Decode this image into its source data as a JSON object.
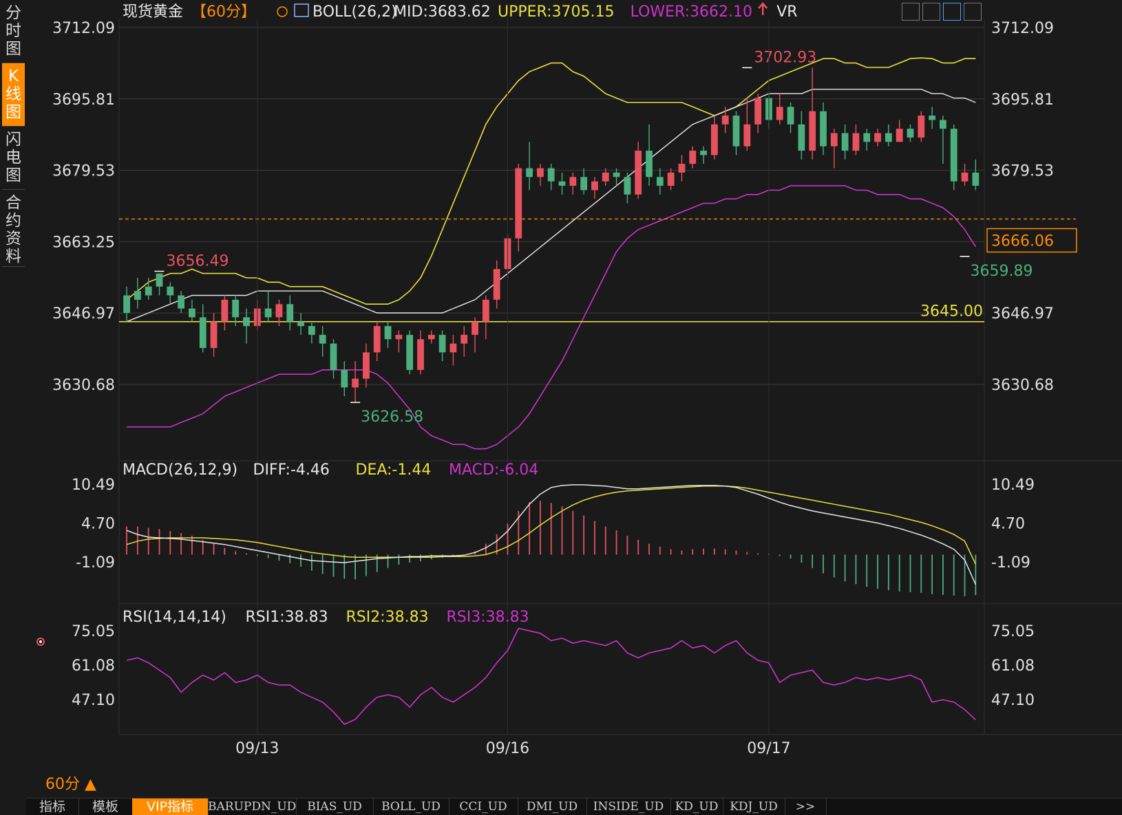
{
  "sidebar": {
    "tabs": [
      "分时图",
      "K线图",
      "闪电图",
      "合约资料"
    ],
    "active": 1
  },
  "period_indicator": "60分 ▲",
  "bottom_tabs": [
    "指标",
    "模板",
    "VIP指标",
    "BARUPDN_UD",
    "BIAS_UD",
    "BOLL_UD",
    "CCI_UD",
    "DMI_UD",
    "INSIDE_UD",
    "KD_UD",
    "KDJ_UD",
    ">>"
  ],
  "active_bottom_tab": 2,
  "colors": {
    "background": "#1a1a1a",
    "grid": "#3a3a3a",
    "up": "#e8525e",
    "down": "#4caf7d",
    "mid": "#e8e8e8",
    "upper": "#e8e040",
    "lower": "#cc33cc",
    "accent": "#ff8c00",
    "highlight_high": "#e8525e",
    "highlight_low": "#4caf7d"
  },
  "toolbar_icons": [
    "grid-icon",
    "bar-chart-icon",
    "line-chart-icon",
    "fullscreen-icon"
  ],
  "chart_data": [
    {
      "type": "candlestick",
      "panel": "main",
      "title": "现货黄金",
      "period_label": "【60分】",
      "indicator_label": "BOLL(26,2)",
      "mid_label": "MID:3683.62",
      "upper_label": "UPPER:3705.15",
      "lower_label": "LOWER:3662.10",
      "extra_label": "VR",
      "y_ticks": [
        "3712.09",
        "3695.81",
        "3679.53",
        "3663.25",
        "3646.97",
        "3630.68"
      ],
      "x_labels": [
        "09/13",
        "09/16",
        "09/17"
      ],
      "x_label_index": [
        12,
        35,
        59
      ],
      "current_price": "3666.06",
      "horizontal_line_label": "3645.00",
      "annotations": [
        {
          "text": "3656.49",
          "index": 3,
          "value": 3656.49,
          "kind": "high"
        },
        {
          "text": "3626.58",
          "index": 21,
          "value": 3626.58,
          "kind": "low"
        },
        {
          "text": "3702.93",
          "index": 57,
          "value": 3702.93,
          "kind": "high"
        },
        {
          "text": "3659.89",
          "index": 77,
          "value": 3659.89,
          "kind": "low"
        }
      ],
      "candles": [
        [
          3651,
          3647,
          3653,
          3645
        ],
        [
          3652,
          3650,
          3655,
          3648
        ],
        [
          3653,
          3651,
          3655,
          3650
        ],
        [
          3656,
          3653,
          3656,
          3651
        ],
        [
          3653,
          3651,
          3654,
          3649
        ],
        [
          3651,
          3648,
          3652,
          3647
        ],
        [
          3648,
          3646,
          3650,
          3645
        ],
        [
          3646,
          3639,
          3649,
          3638
        ],
        [
          3639,
          3645,
          3647,
          3637
        ],
        [
          3645,
          3650,
          3651,
          3643
        ],
        [
          3650,
          3646,
          3651,
          3644
        ],
        [
          3646,
          3644,
          3648,
          3640
        ],
        [
          3644,
          3648,
          3650,
          3643
        ],
        [
          3648,
          3646,
          3652,
          3645
        ],
        [
          3646,
          3649,
          3650,
          3644
        ],
        [
          3649,
          3645,
          3651,
          3643
        ],
        [
          3645,
          3644,
          3647,
          3642
        ],
        [
          3644,
          3642,
          3645,
          3640
        ],
        [
          3642,
          3640,
          3644,
          3637
        ],
        [
          3640,
          3634,
          3641,
          3632
        ],
        [
          3634,
          3630,
          3636,
          3628
        ],
        [
          3630,
          3632,
          3636,
          3626.58
        ],
        [
          3632,
          3638,
          3640,
          3630
        ],
        [
          3638,
          3644,
          3645,
          3636
        ],
        [
          3644,
          3641,
          3645,
          3639
        ],
        [
          3641,
          3642,
          3643,
          3638
        ],
        [
          3642,
          3634,
          3643,
          3633
        ],
        [
          3634,
          3641,
          3643,
          3633
        ],
        [
          3641,
          3642,
          3643,
          3640
        ],
        [
          3642,
          3638,
          3643,
          3636
        ],
        [
          3638,
          3640,
          3642,
          3635
        ],
        [
          3640,
          3642,
          3644,
          3637
        ],
        [
          3642,
          3645,
          3646,
          3638
        ],
        [
          3645,
          3650,
          3651,
          3641
        ],
        [
          3650,
          3657,
          3659,
          3648
        ],
        [
          3657,
          3664,
          3665,
          3655
        ],
        [
          3664,
          3680,
          3681,
          3661
        ],
        [
          3680,
          3678,
          3686,
          3675
        ],
        [
          3678,
          3680,
          3681,
          3676
        ],
        [
          3680,
          3677,
          3681,
          3675
        ],
        [
          3677,
          3676,
          3679,
          3674
        ],
        [
          3676,
          3678,
          3679,
          3674
        ],
        [
          3678,
          3675,
          3680,
          3674
        ],
        [
          3675,
          3677,
          3678,
          3673
        ],
        [
          3677,
          3679,
          3680,
          3676
        ],
        [
          3679,
          3678,
          3680,
          3676
        ],
        [
          3678,
          3674,
          3679,
          3672
        ],
        [
          3674,
          3684,
          3686,
          3673
        ],
        [
          3684,
          3678,
          3690,
          3676
        ],
        [
          3678,
          3676,
          3680,
          3674
        ],
        [
          3676,
          3679,
          3680,
          3675
        ],
        [
          3679,
          3681,
          3683,
          3677
        ],
        [
          3681,
          3684,
          3685,
          3680
        ],
        [
          3684,
          3683,
          3685,
          3681
        ],
        [
          3683,
          3690,
          3692,
          3682
        ],
        [
          3690,
          3692,
          3694,
          3688
        ],
        [
          3692,
          3685,
          3693,
          3683
        ],
        [
          3685,
          3690,
          3696,
          3684
        ],
        [
          3690,
          3696,
          3697,
          3688
        ],
        [
          3696,
          3691,
          3697,
          3689
        ],
        [
          3691,
          3694,
          3697,
          3690
        ],
        [
          3694,
          3690,
          3695,
          3688
        ],
        [
          3690,
          3684,
          3693,
          3682
        ],
        [
          3684,
          3693,
          3702.93,
          3682
        ],
        [
          3693,
          3685,
          3695,
          3683
        ],
        [
          3685,
          3688,
          3689,
          3680
        ],
        [
          3688,
          3684,
          3690,
          3682
        ],
        [
          3684,
          3688,
          3690,
          3683
        ],
        [
          3688,
          3686,
          3689,
          3684
        ],
        [
          3686,
          3688,
          3689,
          3685
        ],
        [
          3688,
          3686,
          3690,
          3685
        ],
        [
          3686,
          3689,
          3691,
          3686
        ],
        [
          3689,
          3687,
          3690,
          3686
        ],
        [
          3687,
          3692,
          3693,
          3686
        ],
        [
          3692,
          3691,
          3694,
          3689
        ],
        [
          3691,
          3689,
          3692,
          3681
        ],
        [
          3689,
          3677,
          3690,
          3675
        ],
        [
          3677,
          3679,
          3681,
          3676
        ],
        [
          3679,
          3676,
          3682,
          3675
        ]
      ],
      "boll_mid": [
        3645,
        3646,
        3647,
        3648,
        3649,
        3650,
        3651,
        3651,
        3651,
        3651,
        3651,
        3651,
        3652,
        3652,
        3652,
        3652,
        3652,
        3652,
        3652,
        3651,
        3650,
        3649,
        3648,
        3647,
        3647,
        3647,
        3647,
        3647,
        3647,
        3647,
        3648,
        3649,
        3650,
        3652,
        3654,
        3656,
        3658,
        3660,
        3662,
        3664,
        3666,
        3668,
        3670,
        3672,
        3674,
        3676,
        3678,
        3680,
        3682,
        3684,
        3686,
        3688,
        3690,
        3691,
        3692,
        3693,
        3694,
        3695,
        3696,
        3697,
        3697,
        3697,
        3697,
        3698,
        3698,
        3698,
        3698,
        3698,
        3698,
        3698,
        3698,
        3698,
        3698,
        3698,
        3697,
        3697,
        3696,
        3696,
        3695
      ],
      "boll_upper": [
        3650,
        3652,
        3654,
        3655,
        3656,
        3656,
        3657,
        3656,
        3656,
        3656,
        3656,
        3655,
        3655,
        3654,
        3654,
        3653,
        3653,
        3653,
        3653,
        3652,
        3651,
        3650,
        3649,
        3649,
        3649,
        3650,
        3652,
        3655,
        3660,
        3666,
        3672,
        3678,
        3684,
        3690,
        3694,
        3697,
        3700,
        3702,
        3703,
        3704,
        3704,
        3702,
        3701,
        3699,
        3697,
        3696,
        3695,
        3695,
        3695,
        3695,
        3695,
        3695,
        3694,
        3693,
        3692,
        3693,
        3694,
        3696,
        3698,
        3700,
        3701,
        3702,
        3703,
        3704,
        3705,
        3705,
        3704,
        3704,
        3703,
        3703,
        3703,
        3704,
        3705,
        3705.15,
        3705,
        3704,
        3704,
        3705,
        3705
      ],
      "boll_lower": [
        3621,
        3621,
        3621,
        3621,
        3621,
        3622,
        3623,
        3624,
        3626,
        3628,
        3629,
        3630,
        3631,
        3632,
        3633,
        3633,
        3633,
        3633,
        3634,
        3634,
        3634,
        3634,
        3634,
        3633,
        3631,
        3628,
        3625,
        3621,
        3619,
        3618,
        3617,
        3617,
        3616,
        3616,
        3617,
        3619,
        3621,
        3624,
        3628,
        3632,
        3636,
        3641,
        3646,
        3651,
        3656,
        3661,
        3664,
        3666,
        3667,
        3668,
        3669,
        3670,
        3671,
        3672,
        3672,
        3673,
        3673,
        3674,
        3674,
        3675,
        3675,
        3676,
        3676,
        3676,
        3676,
        3676,
        3676,
        3675,
        3675,
        3674,
        3674,
        3674,
        3673,
        3673,
        3672,
        3671,
        3669,
        3666,
        3662.1
      ]
    },
    {
      "type": "bar+line",
      "panel": "macd",
      "title": "MACD(26,12,9)",
      "diff_label": "DIFF:-4.46",
      "dea_label": "DEA:-1.44",
      "macd_label": "MACD:-6.04",
      "y_ticks": [
        "10.49",
        "4.70",
        "-1.09"
      ],
      "diff": [
        3.6,
        3.0,
        2.6,
        2.5,
        2.4,
        2.3,
        2.1,
        1.9,
        1.7,
        1.5,
        1.2,
        0.9,
        0.6,
        0.3,
        0.0,
        -0.3,
        -0.6,
        -0.9,
        -1.0,
        -1.1,
        -1.2,
        -1.0,
        -0.8,
        -0.6,
        -0.5,
        -0.4,
        -0.3,
        -0.3,
        -0.2,
        -0.2,
        -0.2,
        -0.1,
        0.3,
        1.0,
        2.0,
        3.5,
        5.5,
        7.5,
        9.0,
        10.0,
        10.3,
        10.4,
        10.4,
        10.3,
        10.2,
        10.0,
        9.8,
        9.8,
        9.9,
        10.0,
        10.1,
        10.2,
        10.3,
        10.3,
        10.3,
        10.2,
        10.0,
        9.5,
        9.0,
        8.4,
        7.8,
        7.3,
        6.9,
        6.5,
        6.2,
        5.9,
        5.6,
        5.3,
        5.0,
        4.7,
        4.3,
        3.9,
        3.4,
        2.9,
        2.3,
        1.6,
        0.8,
        -0.8,
        -4.46
      ],
      "dea": [
        1.5,
        2.0,
        2.3,
        2.4,
        2.5,
        2.5,
        2.5,
        2.5,
        2.4,
        2.3,
        2.2,
        2.0,
        1.8,
        1.5,
        1.2,
        0.9,
        0.6,
        0.3,
        0.1,
        -0.1,
        -0.3,
        -0.4,
        -0.4,
        -0.4,
        -0.4,
        -0.4,
        -0.4,
        -0.4,
        -0.4,
        -0.3,
        -0.3,
        -0.3,
        -0.2,
        0.0,
        0.5,
        1.2,
        2.1,
        3.2,
        4.4,
        5.5,
        6.5,
        7.4,
        8.1,
        8.6,
        9.0,
        9.3,
        9.5,
        9.6,
        9.7,
        9.8,
        9.9,
        10.0,
        10.1,
        10.2,
        10.2,
        10.2,
        10.1,
        9.9,
        9.6,
        9.3,
        9.0,
        8.7,
        8.4,
        8.1,
        7.8,
        7.5,
        7.2,
        6.9,
        6.6,
        6.3,
        6.0,
        5.6,
        5.2,
        4.8,
        4.3,
        3.7,
        3.0,
        2.0,
        -1.44
      ],
      "macd": [
        4.2,
        4.2,
        4.0,
        3.8,
        3.5,
        3.2,
        2.8,
        2.2,
        1.6,
        1.0,
        0.5,
        0.2,
        -0.2,
        -0.5,
        -0.9,
        -1.3,
        -1.8,
        -2.4,
        -2.9,
        -3.3,
        -3.6,
        -3.7,
        -3.2,
        -2.6,
        -2.0,
        -1.5,
        -1.2,
        -1.0,
        -0.7,
        -0.5,
        -0.3,
        -0.1,
        0.5,
        1.6,
        3.0,
        4.6,
        6.5,
        7.8,
        8.0,
        7.7,
        7.2,
        6.5,
        5.8,
        5.0,
        4.2,
        3.6,
        2.8,
        2.2,
        1.6,
        1.2,
        0.8,
        0.6,
        0.8,
        0.9,
        0.9,
        0.8,
        0.6,
        0.4,
        0.2,
        0.1,
        -0.2,
        -0.6,
        -1.2,
        -2.0,
        -2.8,
        -3.4,
        -4.0,
        -4.4,
        -4.8,
        -5.1,
        -5.3,
        -5.5,
        -5.6,
        -5.7,
        -5.9,
        -6.0,
        -6.1,
        -6.2,
        -6.04
      ]
    },
    {
      "type": "line",
      "panel": "rsi",
      "title": "RSI(14,14,14)",
      "rsi1_label": "RSI1:38.83",
      "rsi2_label": "RSI2:38.83",
      "rsi3_label": "RSI3:38.83",
      "y_ticks": [
        "75.05",
        "61.08",
        "47.10"
      ],
      "rsi": [
        63,
        64,
        62,
        59,
        56,
        50,
        54,
        57,
        55,
        58,
        54,
        55,
        57,
        54,
        53,
        53,
        50,
        48,
        46,
        42,
        37,
        39,
        44,
        48,
        49,
        48,
        44,
        49,
        52,
        48,
        46,
        49,
        52,
        56,
        62,
        67,
        76,
        75,
        74,
        71,
        72,
        70,
        71,
        70,
        69,
        71,
        66,
        64,
        66,
        67,
        68,
        71,
        68,
        69,
        66,
        69,
        71,
        66,
        63,
        62,
        54,
        57,
        58,
        59,
        54,
        53,
        54,
        56,
        55,
        56,
        55,
        56,
        57,
        55,
        46,
        47,
        46,
        43,
        38.83
      ]
    }
  ]
}
